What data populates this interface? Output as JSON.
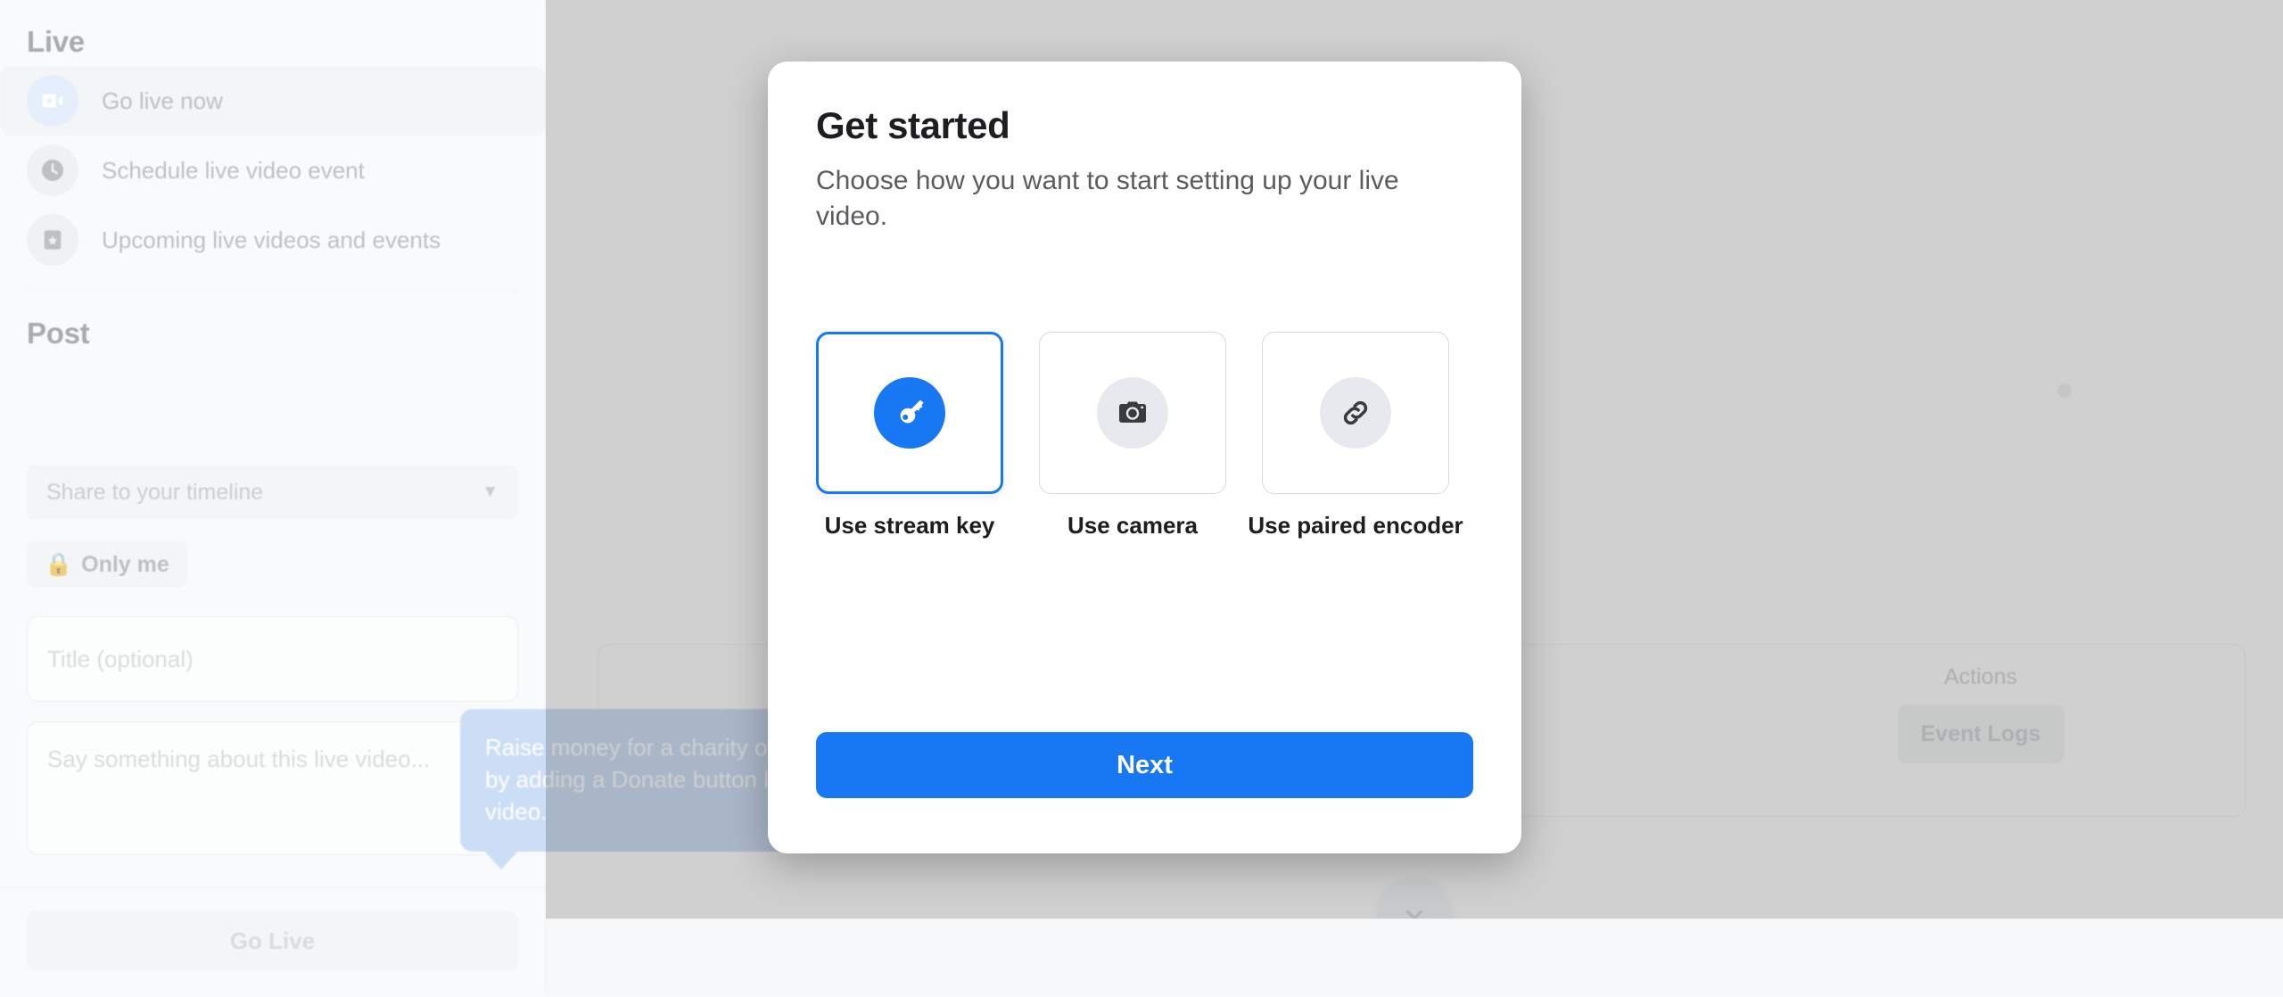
{
  "sidebar": {
    "sections": [
      {
        "title": "Live",
        "items": [
          {
            "label": "Go live now",
            "icon": "video-camera-icon",
            "active": true
          },
          {
            "label": "Schedule live video event",
            "icon": "clock-icon",
            "active": false
          },
          {
            "label": "Upcoming live videos and events",
            "icon": "ticket-star-icon",
            "active": false
          }
        ]
      },
      {
        "title": "Post",
        "items": []
      }
    ],
    "audience_select": {
      "value": "Share to your timeline",
      "chevron": "chevron-down-icon"
    },
    "privacy_badge": {
      "label": "Only me",
      "icon": "lock-icon"
    },
    "title_input": {
      "placeholder": "Title (optional)",
      "value": ""
    },
    "description_input": {
      "placeholder": "Say something about this live video...",
      "value": ""
    },
    "go_live_button": {
      "label": "Go Live",
      "disabled": true
    }
  },
  "tooltip": {
    "text": "Raise money for a charity or by adding a Donate button live video."
  },
  "main": {
    "actions_label": "Actions",
    "event_logs_button": "Event Logs",
    "collapse_icon": "chevron-down-icon"
  },
  "modal": {
    "title": "Get started",
    "subtitle": "Choose how you want to start setting up your live video.",
    "options": [
      {
        "label": "Use stream key",
        "icon": "key-icon",
        "selected": true
      },
      {
        "label": "Use camera",
        "icon": "camera-icon",
        "selected": false
      },
      {
        "label": "Use paired encoder",
        "icon": "link-icon",
        "selected": false
      }
    ],
    "next_button": "Next"
  },
  "colors": {
    "accent_blue": "#1877F2",
    "overlay": "rgba(40,40,40,0.22)",
    "sidebar_bg": "#F5F6F7",
    "tooltip_bg": "#C9DCF5",
    "icon_dark": "#3A3B3C"
  }
}
